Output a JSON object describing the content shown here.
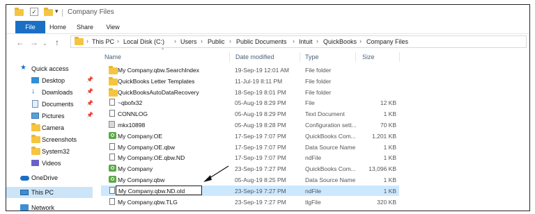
{
  "window": {
    "title": "Company Files"
  },
  "ribbon": {
    "tabs": [
      "File",
      "Home",
      "Share",
      "View"
    ]
  },
  "breadcrumb": [
    "This PC",
    "Local Disk (C:)",
    "Users",
    "Public",
    "Public Documents",
    "Intuit",
    "QuickBooks",
    "Company Files"
  ],
  "sidebar": {
    "items": [
      {
        "label": "Quick access",
        "icon": "star-icon"
      },
      {
        "label": "Desktop",
        "icon": "desktop-icon",
        "pinned": true
      },
      {
        "label": "Downloads",
        "icon": "download-icon",
        "pinned": true
      },
      {
        "label": "Documents",
        "icon": "documents-icon",
        "pinned": true
      },
      {
        "label": "Pictures",
        "icon": "pictures-icon",
        "pinned": true
      },
      {
        "label": "Camera",
        "icon": "folder-icon"
      },
      {
        "label": "Screenshots",
        "icon": "folder-icon"
      },
      {
        "label": "System32",
        "icon": "folder-icon"
      },
      {
        "label": "Videos",
        "icon": "videos-icon"
      },
      {
        "label": "OneDrive",
        "icon": "cloud-icon"
      },
      {
        "label": "This PC",
        "icon": "computer-icon",
        "selected": true
      },
      {
        "label": "Network",
        "icon": "network-icon"
      }
    ]
  },
  "columns": {
    "name": "Name",
    "date": "Date modified",
    "type": "Type",
    "size": "Size"
  },
  "files": [
    {
      "name": "My Company.qbw.SearchIndex",
      "date": "19-Sep-19 12:01 AM",
      "type": "File folder",
      "size": "",
      "icon": "folder"
    },
    {
      "name": "QuickBooks Letter Templates",
      "date": "11-Jul-19 8:11 PM",
      "type": "File folder",
      "size": "",
      "icon": "folder"
    },
    {
      "name": "QuickBooksAutoDataRecovery",
      "date": "18-Sep-19 8:01 PM",
      "type": "File folder",
      "size": "",
      "icon": "folder"
    },
    {
      "name": "~qbofx32",
      "date": "05-Aug-19 8:29 PM",
      "type": "File",
      "size": "12 KB",
      "icon": "doc"
    },
    {
      "name": "CONNLOG",
      "date": "05-Aug-19 8:29 PM",
      "type": "Text Document",
      "size": "1 KB",
      "icon": "doc"
    },
    {
      "name": "mkx10898",
      "date": "05-Aug-19 8:28 PM",
      "type": "Configuration sett...",
      "size": "70 KB",
      "icon": "cfg"
    },
    {
      "name": "My Company.OE",
      "date": "17-Sep-19 7:07 PM",
      "type": "QuickBooks Com...",
      "size": "1,201 KB",
      "icon": "qb"
    },
    {
      "name": "My Company.OE.qbw",
      "date": "17-Sep-19 7:07 PM",
      "type": "Data Source Name",
      "size": "1 KB",
      "icon": "doc"
    },
    {
      "name": "My Company.OE.qbw.ND",
      "date": "17-Sep-19 7:07 PM",
      "type": "ndFile",
      "size": "1 KB",
      "icon": "doc"
    },
    {
      "name": "My Company",
      "date": "23-Sep-19 7:27 PM",
      "type": "QuickBooks Com...",
      "size": "13,096 KB",
      "icon": "qb"
    },
    {
      "name": "My Company.qbw",
      "date": "05-Aug-19 8:25 PM",
      "type": "Data Source Name",
      "size": "1 KB",
      "icon": "qb"
    },
    {
      "name": "My Company.qbw.ND.old",
      "date": "23-Sep-19 7:27 PM",
      "type": "ndFile",
      "size": "1 KB",
      "icon": "doc",
      "editing": true
    },
    {
      "name": "My Company.qbw.TLG",
      "date": "23-Sep-19 7:27 PM",
      "type": "tlgFile",
      "size": "320 KB",
      "icon": "doc"
    }
  ],
  "colors": {
    "accent": "#1a6fc4",
    "selection": "#cce8ff",
    "folder": "#f5c542",
    "quickbooks": "#5aa946"
  }
}
